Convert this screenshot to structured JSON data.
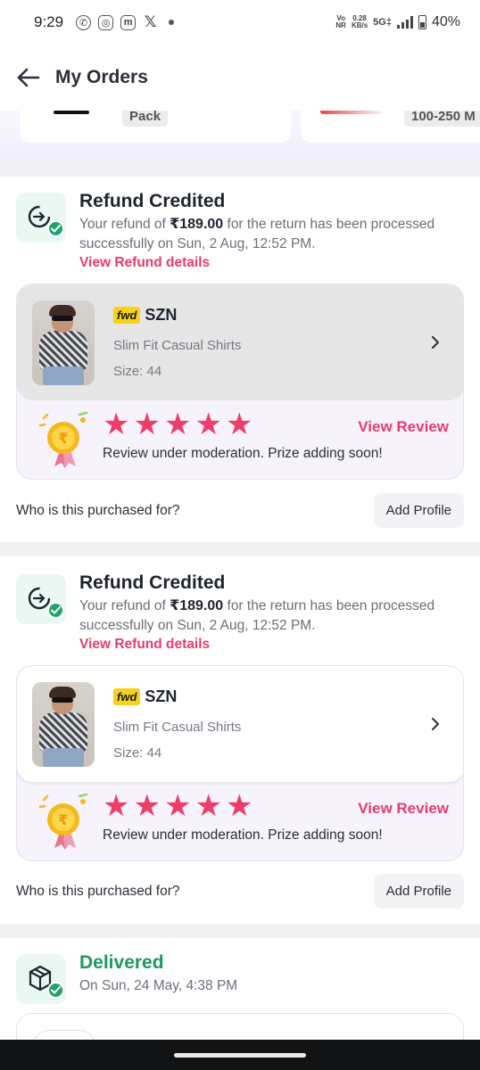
{
  "status_bar": {
    "time": "9:29",
    "app_icons": [
      "whatsapp-icon",
      "instagram-icon",
      "m-icon",
      "x-icon"
    ],
    "volte": "Vo\nNR",
    "speed": "0.28",
    "speed_unit": "KB/s",
    "network": "5G‡",
    "battery": "40%"
  },
  "header": {
    "title": "My Orders"
  },
  "prev_order": {
    "left_pill": "Pack",
    "right_pill": "100-250 M"
  },
  "orders": [
    {
      "status_title": "Refund Credited",
      "desc_prefix": "Your refund of ",
      "amount": "₹189.00",
      "desc_suffix": " for the return has been processed successfully on Sun, 2 Aug, 12:52 PM.",
      "link": "View Refund details",
      "brand_logo": "fwd",
      "brand": "SZN",
      "product": "Slim Fit Casual Shirts",
      "size": "Size: 44",
      "rating": 5,
      "review_note": "Review under moderation. Prize adding soon!",
      "review_link": "View Review",
      "purchase_question": "Who is this purchased for?",
      "add_profile": "Add Profile"
    },
    {
      "status_title": "Refund Credited",
      "desc_prefix": "Your refund of ",
      "amount": "₹189.00",
      "desc_suffix": " for the return has been processed successfully on Sun, 2 Aug, 12:52 PM.",
      "link": "View Refund details",
      "brand_logo": "fwd",
      "brand": "SZN",
      "product": "Slim Fit Casual Shirts",
      "size": "Size: 44",
      "rating": 5,
      "review_note": "Review under moderation. Prize adding soon!",
      "review_link": "View Review",
      "purchase_question": "Who is this purchased for?",
      "add_profile": "Add Profile"
    }
  ],
  "delivered": {
    "status_title": "Delivered",
    "date": "On Sun, 24 May, 4:38 PM"
  },
  "colors": {
    "accent_pink": "#e83c6d",
    "star": "#ef3d6a",
    "success_green": "#1d9a5e"
  }
}
